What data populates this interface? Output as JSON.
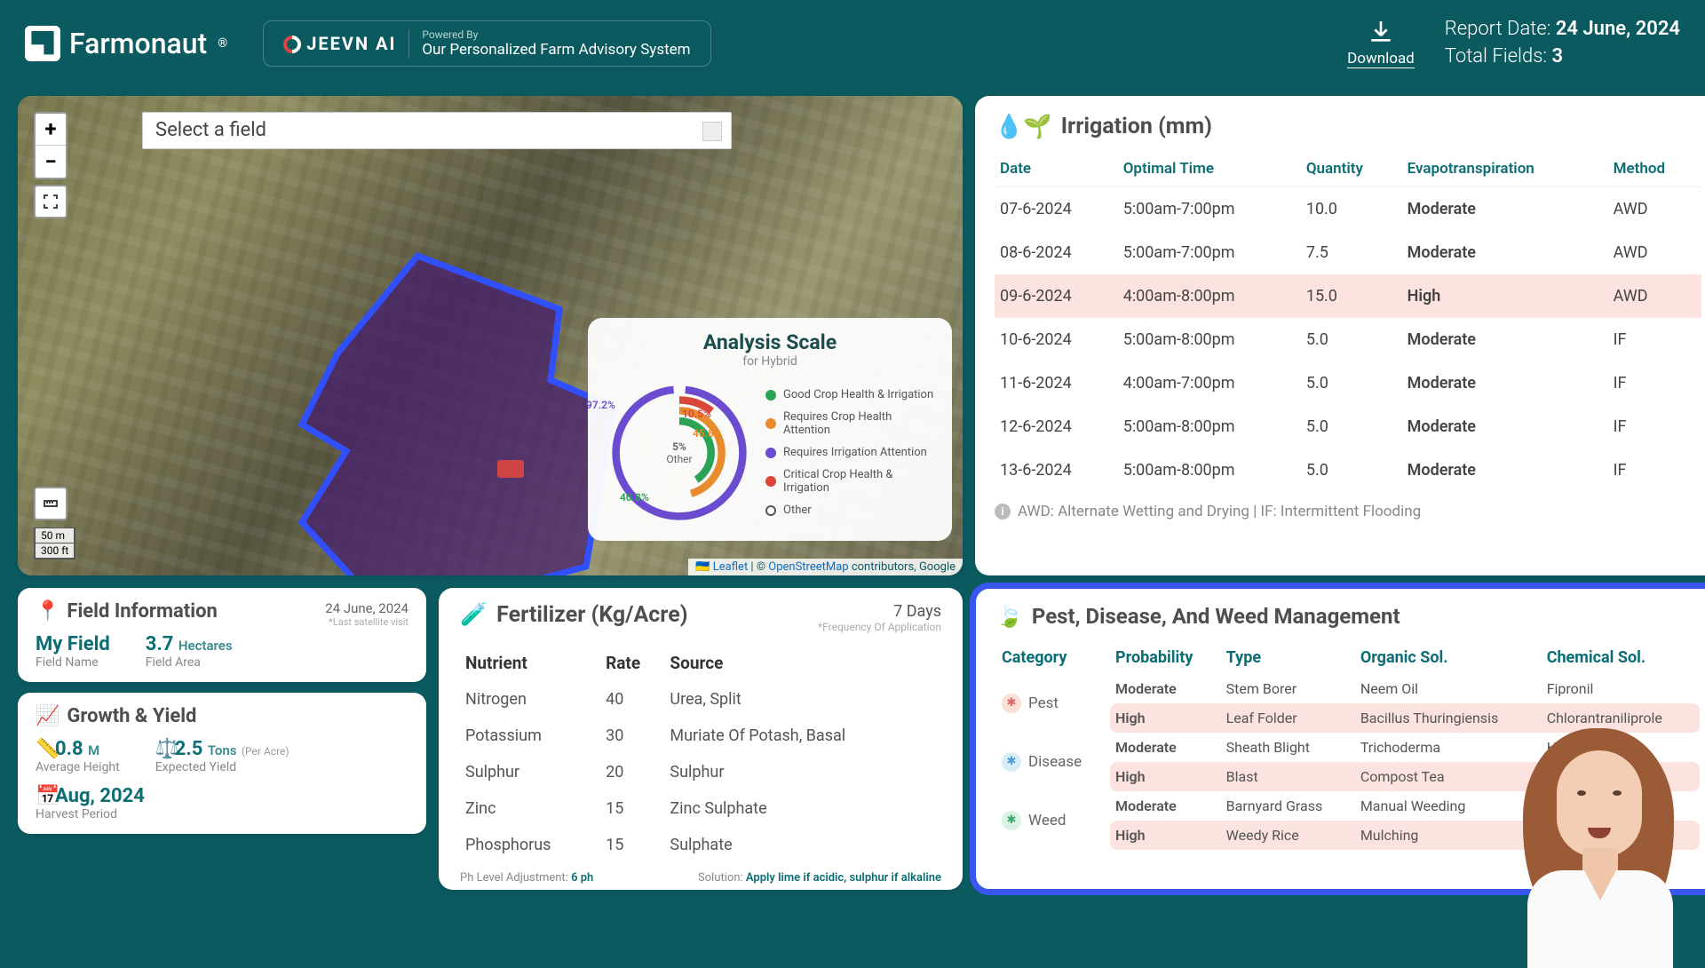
{
  "brand": {
    "name": "Farmonaut",
    "reg": "®"
  },
  "partner": {
    "mark": "JEEVN AI",
    "powered": "Powered By",
    "desc": "Our Personalized Farm Advisory System"
  },
  "download": "Download",
  "report": {
    "date_label": "Report Date:",
    "date_value": "24 June, 2024",
    "fields_label": "Total Fields:",
    "fields_value": "3"
  },
  "map": {
    "select_placeholder": "Select a field",
    "scale_m": "50 m",
    "scale_ft": "300 ft",
    "attrib_leaflet": "Leaflet",
    "attrib_osm": "OpenStreetMap",
    "attrib_tail": " contributors, Google",
    "analysis": {
      "title": "Analysis Scale",
      "sub": "for Hybrid",
      "center_pct": "5%",
      "center_lbl": "Other",
      "rings": [
        {
          "pct": "97.2%",
          "color": "#6b4bd0"
        },
        {
          "pct": "10.5%",
          "color": "#d9473a"
        },
        {
          "pct": "45.8%",
          "color": "#e88b2c"
        },
        {
          "pct": "40.8%",
          "color": "#2aa356"
        }
      ],
      "legend": [
        {
          "color": "#2aa356",
          "label": "Good Crop Health & Irrigation"
        },
        {
          "color": "#e88b2c",
          "label": "Requires Crop Health Attention"
        },
        {
          "color": "#6b4bd0",
          "label": "Requires Irrigation Attention"
        },
        {
          "color": "#d9473a",
          "label": "Critical Crop Health & Irrigation"
        },
        {
          "color": "#ffffff",
          "label": "Other",
          "ring": true
        }
      ]
    }
  },
  "irrigation": {
    "title": "Irrigation (mm)",
    "cols": [
      "Date",
      "Optimal Time",
      "Quantity",
      "Evapotranspiration",
      "Method"
    ],
    "rows": [
      {
        "date": "07-6-2024",
        "time": "5:00am-7:00pm",
        "qty": "10.0",
        "et": "Moderate",
        "method": "AWD"
      },
      {
        "date": "08-6-2024",
        "time": "5:00am-7:00pm",
        "qty": "7.5",
        "et": "Moderate",
        "method": "AWD"
      },
      {
        "date": "09-6-2024",
        "time": "4:00am-8:00pm",
        "qty": "15.0",
        "et": "High",
        "method": "AWD",
        "high": true
      },
      {
        "date": "10-6-2024",
        "time": "5:00am-8:00pm",
        "qty": "5.0",
        "et": "Moderate",
        "method": "IF"
      },
      {
        "date": "11-6-2024",
        "time": "4:00am-7:00pm",
        "qty": "5.0",
        "et": "Moderate",
        "method": "IF"
      },
      {
        "date": "12-6-2024",
        "time": "5:00am-8:00pm",
        "qty": "5.0",
        "et": "Moderate",
        "method": "IF"
      },
      {
        "date": "13-6-2024",
        "time": "5:00am-8:00pm",
        "qty": "5.0",
        "et": "Moderate",
        "method": "IF"
      }
    ],
    "footnote": "AWD: Alternate Wetting and Drying | IF: Intermittent Flooding"
  },
  "field_info": {
    "title": "Field Information",
    "date": "24 June, 2024",
    "date_sub": "*Last satellite visit",
    "name_v": "My Field",
    "name_k": "Field Name",
    "area_v": "3.7",
    "area_unit": "Hectares",
    "area_k": "Field Area"
  },
  "growth": {
    "title": "Growth & Yield",
    "h_v": "0.8",
    "h_unit": "M",
    "h_k": "Average Height",
    "y_v": "2.5",
    "y_unit": "Tons",
    "y_unit2": "(Per Acre)",
    "y_k": "Expected Yield",
    "harvest_v": "Aug, 2024",
    "harvest_k": "Harvest Period"
  },
  "fertilizer": {
    "title": "Fertilizer (Kg/Acre)",
    "days": "7 Days",
    "days_sub": "*Frequency Of Application",
    "cols": [
      "Nutrient",
      "Rate",
      "Source"
    ],
    "rows": [
      {
        "n": "Nitrogen",
        "r": "40",
        "s": "Urea, Split"
      },
      {
        "n": "Potassium",
        "r": "30",
        "s": "Muriate Of Potash, Basal"
      },
      {
        "n": "Sulphur",
        "r": "20",
        "s": "Sulphur"
      },
      {
        "n": "Zinc",
        "r": "15",
        "s": "Zinc Sulphate"
      },
      {
        "n": "Phosphorus",
        "r": "15",
        "s": "Sulphate"
      }
    ],
    "ph_lbl": "Ph Level Adjustment:",
    "ph_v": "6 ph",
    "sol_lbl": "Solution:",
    "sol_v": "Apply lime if acidic, sulphur if alkaline"
  },
  "pdw": {
    "title": "Pest, Disease, And Weed Management",
    "cols": [
      "Category",
      "Probability",
      "Type",
      "Organic Sol.",
      "Chemical Sol."
    ],
    "groups": [
      {
        "cat": "Pest",
        "icon_bg": "#fbe0d8",
        "icon_fg": "#d66",
        "rows": [
          {
            "prob": "Moderate",
            "type": "Stem Borer",
            "org": "Neem Oil",
            "chem": "Fipronil"
          },
          {
            "prob": "High",
            "type": "Leaf Folder",
            "org": "Bacillus Thuringiensis",
            "chem": "Chlorantraniliprole",
            "high": true
          }
        ]
      },
      {
        "cat": "Disease",
        "icon_bg": "#d8ecf8",
        "icon_fg": "#4a9bd6",
        "rows": [
          {
            "prob": "Moderate",
            "type": "Sheath Blight",
            "org": "Trichoderma",
            "chem": "Hexaconazole"
          },
          {
            "prob": "High",
            "type": "Blast",
            "org": "Compost Tea",
            "chem": "",
            "high": true
          }
        ]
      },
      {
        "cat": "Weed",
        "icon_bg": "#d8f3e3",
        "icon_fg": "#3aaa6e",
        "rows": [
          {
            "prob": "Moderate",
            "type": "Barnyard Grass",
            "org": "Manual Weeding",
            "chem": ""
          },
          {
            "prob": "High",
            "type": "Weedy Rice",
            "org": "Mulching",
            "chem": "",
            "high": true
          }
        ]
      }
    ]
  }
}
